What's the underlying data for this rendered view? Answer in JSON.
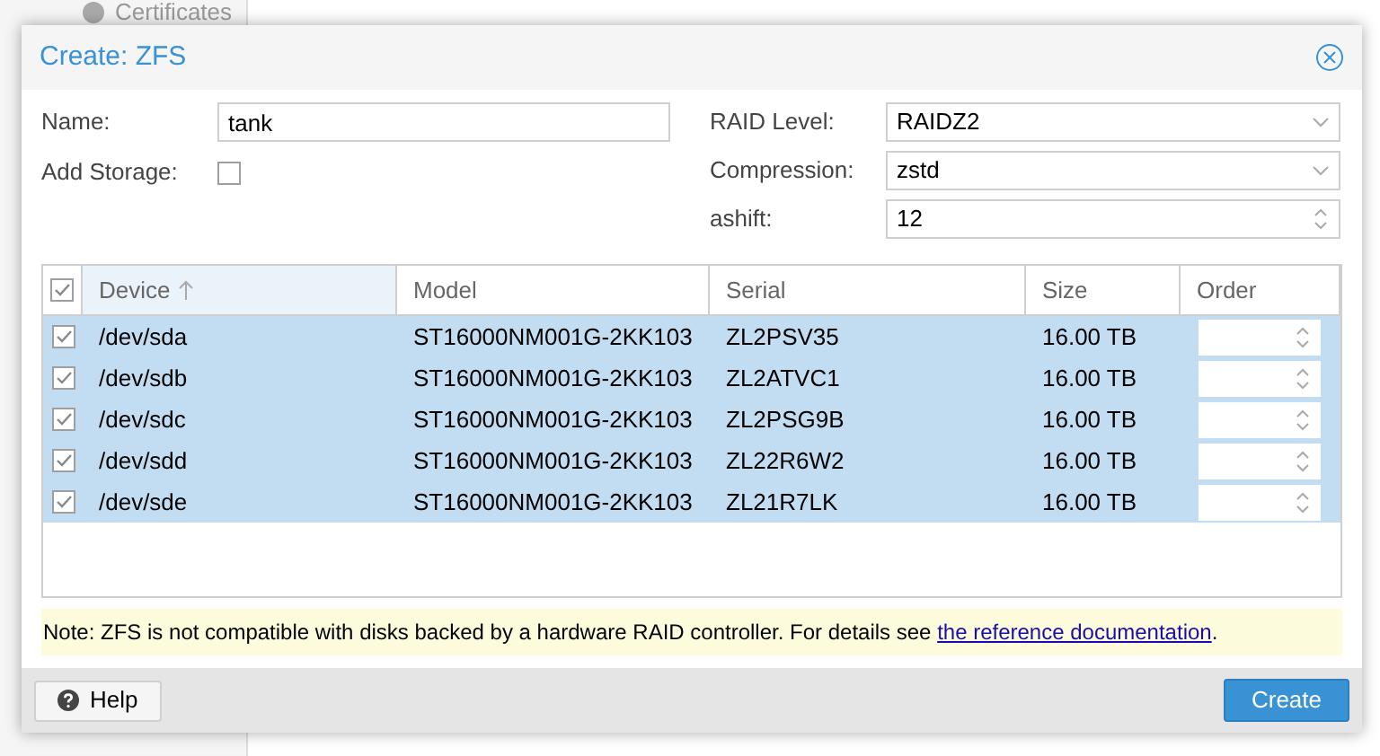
{
  "background": {
    "sidebar_item": "Certificates"
  },
  "dialog": {
    "title": "Create: ZFS"
  },
  "form": {
    "name": {
      "label": "Name:",
      "value": "tank"
    },
    "add_storage": {
      "label": "Add Storage:",
      "checked": false
    },
    "raid_level": {
      "label": "RAID Level:",
      "value": "RAIDZ2"
    },
    "compression": {
      "label": "Compression:",
      "value": "zstd"
    },
    "ashift": {
      "label": "ashift:",
      "value": "12"
    }
  },
  "table": {
    "all_checked": true,
    "columns": [
      {
        "label": "Device",
        "sorted": true
      },
      {
        "label": "Model",
        "sorted": false
      },
      {
        "label": "Serial",
        "sorted": false
      },
      {
        "label": "Size",
        "sorted": false
      },
      {
        "label": "Order",
        "sorted": false
      }
    ],
    "rows": [
      {
        "device": "/dev/sda",
        "model": "ST16000NM001G-2KK103",
        "serial": "ZL2PSV35",
        "size": "16.00 TB",
        "checked": true,
        "selected": true
      },
      {
        "device": "/dev/sdb",
        "model": "ST16000NM001G-2KK103",
        "serial": "ZL2ATVC1",
        "size": "16.00 TB",
        "checked": true,
        "selected": true
      },
      {
        "device": "/dev/sdc",
        "model": "ST16000NM001G-2KK103",
        "serial": "ZL2PSG9B",
        "size": "16.00 TB",
        "checked": true,
        "selected": true
      },
      {
        "device": "/dev/sdd",
        "model": "ST16000NM001G-2KK103",
        "serial": "ZL22R6W2",
        "size": "16.00 TB",
        "checked": true,
        "selected": true
      },
      {
        "device": "/dev/sde",
        "model": "ST16000NM001G-2KK103",
        "serial": "ZL21R7LK",
        "size": "16.00 TB",
        "checked": true,
        "selected": true
      }
    ]
  },
  "note": {
    "text": "Note: ZFS is not compatible with disks backed by a hardware RAID controller. For details see",
    "link": "the reference documentation",
    "end": "."
  },
  "buttons": {
    "help": "Help",
    "create": "Create"
  }
}
